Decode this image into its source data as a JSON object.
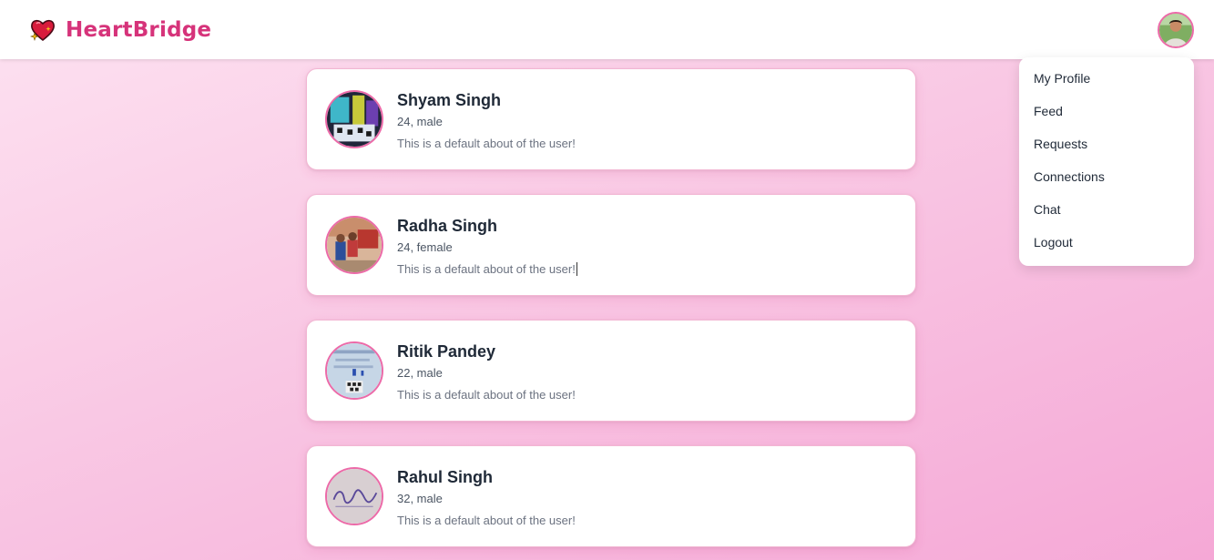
{
  "brand": {
    "name": "HeartBridge",
    "logo_icon": "heart-sparkle-icon"
  },
  "user_menu": {
    "avatar_icon": "user-avatar",
    "items": [
      {
        "label": "My Profile"
      },
      {
        "label": "Feed"
      },
      {
        "label": "Requests"
      },
      {
        "label": "Connections"
      },
      {
        "label": "Chat"
      },
      {
        "label": "Logout"
      }
    ]
  },
  "feed": {
    "users": [
      {
        "name": "Shyam Singh",
        "meta": "24, male",
        "about": "This is a default about of the user!"
      },
      {
        "name": "Radha Singh",
        "meta": "24, female",
        "about": "This is a default about of the user!"
      },
      {
        "name": "Ritik Pandey",
        "meta": "22, male",
        "about": "This is a default about of the user!"
      },
      {
        "name": "Rahul Singh",
        "meta": "32, male",
        "about": "This is a default about of the user!"
      }
    ]
  },
  "colors": {
    "brand": "#d6337a",
    "avatar_border": "#ec6aa8",
    "background_start": "#fde2f1",
    "background_end": "#f5a8d6"
  }
}
